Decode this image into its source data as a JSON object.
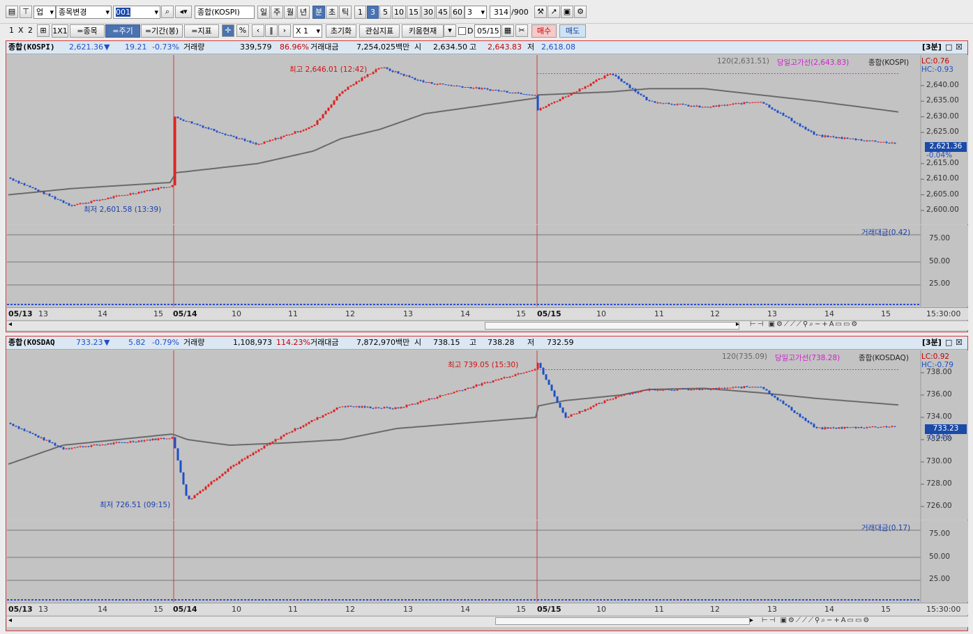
{
  "toolbar1": {
    "market_select": "업",
    "stock_change": "종목변경",
    "code_value": "001",
    "name_value": "종합(KOSPI)",
    "periods": [
      "일",
      "주",
      "월",
      "년",
      "분",
      "초",
      "틱"
    ],
    "active_period": "분",
    "intervals": [
      "1",
      "3",
      "5",
      "10",
      "15",
      "30",
      "45",
      "60"
    ],
    "active_interval": "3",
    "interval_select": "3",
    "count_value": "314",
    "count_max": "/900"
  },
  "toolbar2": {
    "layout_labels": [
      "1",
      "X",
      "2"
    ],
    "layout_1x1": "1X1",
    "btn_stock": "=종목",
    "btn_period": "=주기",
    "btn_range": "=기간(봉)",
    "btn_indicator": "=지표",
    "pct": "%",
    "zoom": "X 1",
    "btn_reset": "초기화",
    "btn_interest": "관심지표",
    "btn_kiwoom": "키움현재",
    "d_label": "D",
    "date_value": "05/15",
    "btn_buy": "매수",
    "btn_sell": "매도"
  },
  "kospi": {
    "name": "종합(KOSPI)",
    "price": "2,621.36",
    "arrow": "▼",
    "change": "19.21",
    "change_pct": "-0.73%",
    "vol_label": "거래량",
    "volume": "339,579",
    "vol_ratio": "86.96%",
    "amt_label": "거래대금",
    "amount": "7,254,025백만",
    "open_label": "시",
    "open": "2,634.50",
    "high_label": "고",
    "high": "2,643.83",
    "low_label": "저",
    "low": "2,618.08",
    "period_tag": "[3분]",
    "ma_legend": "120(2,631.51)",
    "high_line_legend": "당일고가선(2,643.83)",
    "series_legend": "종합(KOSPI)",
    "lc": "LC:0.76",
    "hc": "HC:-0.93",
    "last_price_box": "2,621.36",
    "last_pct": "-0.04%",
    "max_label": "최고 2,646.01 (12:42)",
    "min_label": "최저 2,601.58 (13:39)",
    "y_ticks": [
      "2,640.00",
      "2,635.00",
      "2,630.00",
      "2,625.00",
      "2,615.00",
      "2,610.00",
      "2,605.00",
      "2,600.00"
    ],
    "sub_legend": "거래대금(0.42)",
    "sub_ticks": [
      "75.00",
      "50.00",
      "25.00"
    ],
    "x_labels": [
      "05/13",
      "13",
      "14",
      "15",
      "05/14",
      "10",
      "11",
      "12",
      "13",
      "14",
      "15",
      "05/15",
      "10",
      "11",
      "12",
      "13",
      "14",
      "15"
    ],
    "time_label": "15:30:00"
  },
  "kosdaq": {
    "name": "종합(KOSDAQ",
    "price": "733.23",
    "arrow": "▼",
    "change": "5.82",
    "change_pct": "-0.79%",
    "vol_label": "거래량",
    "volume": "1,108,973",
    "vol_ratio": "114.23%",
    "amt_label": "거래대금",
    "amount": "7,872,970백만",
    "open_label": "시",
    "open": "738.15",
    "high_label": "고",
    "high": "738.28",
    "low_label": "저",
    "low": "732.59",
    "period_tag": "[3분]",
    "ma_legend": "120(735.09)",
    "high_line_legend": "당일고가선(738.28)",
    "series_legend": "종합(KOSDAQ)",
    "lc": "LC:0.92",
    "hc": "HC:-0.79",
    "last_price_box": "733.23",
    "last_pct": "-0.04%",
    "max_label": "최고 739.05 (15:30)",
    "min_label": "최저 726.51 (09:15)",
    "y_ticks": [
      "738.00",
      "736.00",
      "734.00",
      "732.00",
      "730.00",
      "728.00",
      "726.00"
    ],
    "sub_legend": "거래대금(0.17)",
    "sub_ticks": [
      "75.00",
      "50.00",
      "25.00"
    ],
    "x_labels": [
      "05/13",
      "13",
      "14",
      "15",
      "05/14",
      "10",
      "11",
      "12",
      "13",
      "14",
      "15",
      "05/15",
      "10",
      "11",
      "12",
      "13",
      "14",
      "15"
    ],
    "time_label": "15:30:00"
  },
  "colors": {
    "up": "#e0201f",
    "down": "#1e4fc8",
    "ma": "#6a6a6a",
    "highline": "#e020e0",
    "frame": "#d23a3a"
  },
  "chart_data": [
    {
      "type": "line",
      "title": "종합(KOSPI)",
      "xlabel": "",
      "ylabel": "",
      "ylim": [
        2598,
        2648
      ],
      "x": [
        "05/13 12:30",
        "05/13 13:39",
        "05/13 15:30",
        "05/14 09:00",
        "05/14 10:30",
        "05/14 11:30",
        "05/14 12:00",
        "05/14 12:42",
        "05/14 13:30",
        "05/14 15:30",
        "05/15 09:00",
        "05/15 10:20",
        "05/15 11:00",
        "05/15 12:00",
        "05/15 13:00",
        "05/15 14:00",
        "05/15 15:30"
      ],
      "series": [
        {
          "name": "종합(KOSPI)",
          "values": [
            2610.5,
            2601.6,
            2608,
            2630,
            2621,
            2627,
            2638,
            2646,
            2641,
            2637,
            2632,
            2644,
            2635,
            2633,
            2635,
            2624,
            2621.4
          ]
        },
        {
          "name": "120",
          "values": [
            2605,
            2607,
            2609,
            2612,
            2615,
            2619,
            2623,
            2626,
            2631,
            2636,
            2637,
            2638,
            2639,
            2639,
            2637,
            2635,
            2631.5
          ]
        }
      ]
    },
    {
      "type": "line",
      "title": "종합(KOSDAQ)",
      "xlabel": "",
      "ylabel": "",
      "ylim": [
        725.5,
        739.5
      ],
      "x": [
        "05/13 12:30",
        "05/13 13:30",
        "05/13 15:30",
        "05/14 09:15",
        "05/14 10:00",
        "05/14 11:00",
        "05/14 12:00",
        "05/14 13:00",
        "05/14 15:30",
        "05/15 09:00",
        "05/15 09:30",
        "05/15 10:30",
        "05/15 11:00",
        "05/15 12:00",
        "05/15 13:00",
        "05/15 14:00",
        "05/15 15:30"
      ],
      "series": [
        {
          "name": "종합(KOSDAQ)",
          "values": [
            733.5,
            731.2,
            732.2,
            726.5,
            729.5,
            732.5,
            735,
            734.8,
            738.4,
            739,
            734,
            736,
            736.5,
            736.5,
            736.8,
            733,
            733.2
          ]
        },
        {
          "name": "120",
          "values": [
            729.8,
            731.5,
            732.5,
            732,
            731.5,
            731.7,
            732,
            733,
            734,
            735,
            735.5,
            736,
            736.5,
            736.6,
            736.2,
            735.7,
            735.1
          ]
        }
      ]
    }
  ]
}
